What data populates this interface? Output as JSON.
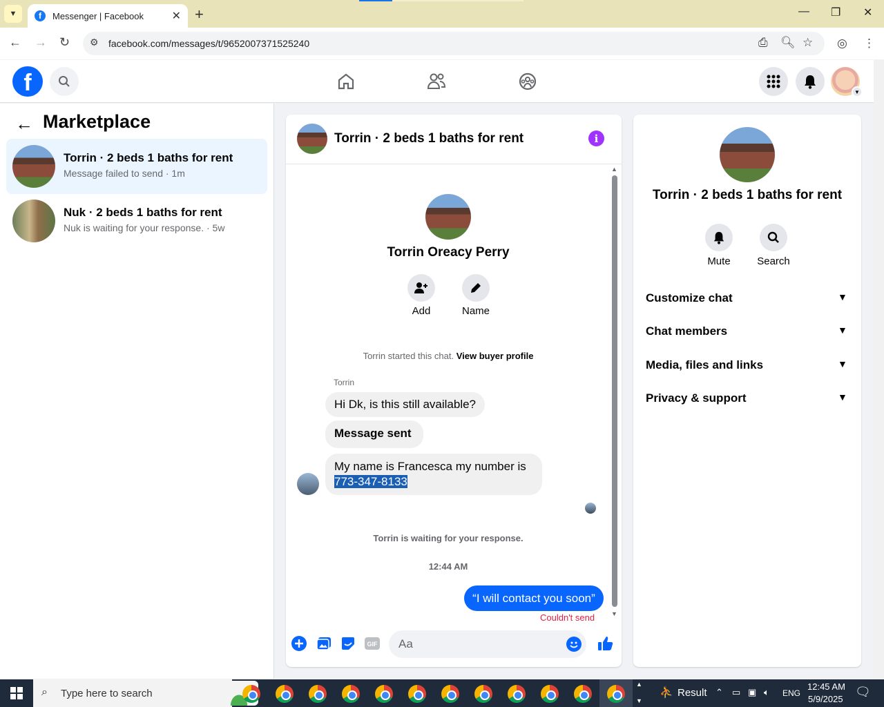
{
  "browser": {
    "tab_title": "Messenger | Facebook",
    "url": "facebook.com/messages/t/9652007371525240"
  },
  "sidebar": {
    "title": "Marketplace",
    "conversations": [
      {
        "name": "Torrin · 2 beds 1 baths for rent",
        "snippet": "Message failed to send · 1m"
      },
      {
        "name": "Nuk · 2 beds 1 baths for rent",
        "snippet": "Nuk is waiting for your response. · 5w"
      }
    ]
  },
  "chat": {
    "header_title": "Torrin · 2 beds 1 baths for rent",
    "contact_name": "Torrin Oreacy Perry",
    "add_label": "Add",
    "name_label": "Name",
    "started_text": "Torrin started this chat.",
    "view_profile": "View buyer profile",
    "sender": "Torrin",
    "messages": [
      {
        "text": "Hi Dk, is this still available?"
      },
      {
        "text": "Message sent"
      },
      {
        "text_line1": "My name is Francesca my number is",
        "text_line2": "773-347-8133"
      }
    ],
    "waiting_text": "Torrin is waiting for your response.",
    "time": "12:44 AM",
    "my_message": "“I will contact you soon”",
    "error": "Couldn't send",
    "input_placeholder": "Aa"
  },
  "details": {
    "title": "Torrin · 2 beds 1 baths for rent",
    "mute_label": "Mute",
    "search_label": "Search",
    "sections": [
      "Customize chat",
      "Chat members",
      "Media, files and links",
      "Privacy & support"
    ]
  },
  "taskbar": {
    "search_placeholder": "Type here to search",
    "result_label": "Result",
    "lang": "ENG",
    "clock_time": "12:45 AM",
    "clock_date": "5/9/2025"
  }
}
